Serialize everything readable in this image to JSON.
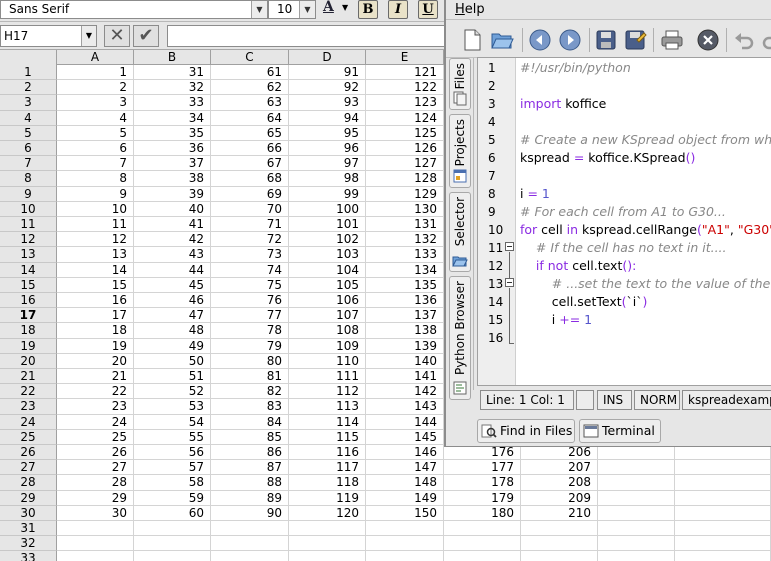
{
  "spreadsheet": {
    "font_name": "Sans Serif",
    "font_size": "10",
    "bold_label": "B",
    "italic_label": "I",
    "underline_label": "U",
    "font_color_label": "A",
    "cell_reference": "H17",
    "cancel_glyph": "✕",
    "accept_glyph": "✔",
    "formula_value": "",
    "active_row": 17,
    "columns": [
      "A",
      "B",
      "C",
      "D",
      "E"
    ],
    "rows": [
      {
        "label": "1",
        "cells": [
          "1",
          "31",
          "61",
          "91",
          "121",
          "",
          ""
        ]
      },
      {
        "label": "2",
        "cells": [
          "2",
          "32",
          "62",
          "92",
          "122",
          "",
          ""
        ]
      },
      {
        "label": "3",
        "cells": [
          "3",
          "33",
          "63",
          "93",
          "123",
          "",
          ""
        ]
      },
      {
        "label": "4",
        "cells": [
          "4",
          "34",
          "64",
          "94",
          "124",
          "",
          ""
        ]
      },
      {
        "label": "5",
        "cells": [
          "5",
          "35",
          "65",
          "95",
          "125",
          "",
          ""
        ]
      },
      {
        "label": "6",
        "cells": [
          "6",
          "36",
          "66",
          "96",
          "126",
          "",
          ""
        ]
      },
      {
        "label": "7",
        "cells": [
          "7",
          "37",
          "67",
          "97",
          "127",
          "",
          ""
        ]
      },
      {
        "label": "8",
        "cells": [
          "8",
          "38",
          "68",
          "98",
          "128",
          "",
          ""
        ]
      },
      {
        "label": "9",
        "cells": [
          "9",
          "39",
          "69",
          "99",
          "129",
          "",
          ""
        ]
      },
      {
        "label": "10",
        "cells": [
          "10",
          "40",
          "70",
          "100",
          "130",
          "",
          ""
        ]
      },
      {
        "label": "11",
        "cells": [
          "11",
          "41",
          "71",
          "101",
          "131",
          "",
          ""
        ]
      },
      {
        "label": "12",
        "cells": [
          "12",
          "42",
          "72",
          "102",
          "132",
          "",
          ""
        ]
      },
      {
        "label": "13",
        "cells": [
          "13",
          "43",
          "73",
          "103",
          "133",
          "",
          ""
        ]
      },
      {
        "label": "14",
        "cells": [
          "14",
          "44",
          "74",
          "104",
          "134",
          "",
          ""
        ]
      },
      {
        "label": "15",
        "cells": [
          "15",
          "45",
          "75",
          "105",
          "135",
          "",
          ""
        ]
      },
      {
        "label": "16",
        "cells": [
          "16",
          "46",
          "76",
          "106",
          "136",
          "",
          ""
        ]
      },
      {
        "label": "17",
        "cells": [
          "17",
          "47",
          "77",
          "107",
          "137",
          "",
          ""
        ]
      },
      {
        "label": "18",
        "cells": [
          "18",
          "48",
          "78",
          "108",
          "138",
          "",
          ""
        ]
      },
      {
        "label": "19",
        "cells": [
          "19",
          "49",
          "79",
          "109",
          "139",
          "",
          ""
        ]
      },
      {
        "label": "20",
        "cells": [
          "20",
          "50",
          "80",
          "110",
          "140",
          "",
          ""
        ]
      },
      {
        "label": "21",
        "cells": [
          "21",
          "51",
          "81",
          "111",
          "141",
          "",
          ""
        ]
      },
      {
        "label": "22",
        "cells": [
          "22",
          "52",
          "82",
          "112",
          "142",
          "",
          ""
        ]
      },
      {
        "label": "23",
        "cells": [
          "23",
          "53",
          "83",
          "113",
          "143",
          "",
          ""
        ]
      },
      {
        "label": "24",
        "cells": [
          "24",
          "54",
          "84",
          "114",
          "144",
          "",
          ""
        ]
      },
      {
        "label": "25",
        "cells": [
          "25",
          "55",
          "85",
          "115",
          "145",
          "",
          ""
        ]
      },
      {
        "label": "26",
        "cells": [
          "26",
          "56",
          "86",
          "116",
          "146",
          "176",
          "206"
        ]
      },
      {
        "label": "27",
        "cells": [
          "27",
          "57",
          "87",
          "117",
          "147",
          "177",
          "207"
        ]
      },
      {
        "label": "28",
        "cells": [
          "28",
          "58",
          "88",
          "118",
          "148",
          "178",
          "208"
        ]
      },
      {
        "label": "29",
        "cells": [
          "29",
          "59",
          "89",
          "119",
          "149",
          "179",
          "209"
        ]
      },
      {
        "label": "30",
        "cells": [
          "30",
          "60",
          "90",
          "120",
          "150",
          "180",
          "210"
        ]
      },
      {
        "label": "31",
        "cells": [
          "",
          "",
          "",
          "",
          "",
          "",
          ""
        ]
      },
      {
        "label": "32",
        "cells": [
          "",
          "",
          "",
          "",
          "",
          "",
          ""
        ]
      },
      {
        "label": "33",
        "cells": [
          "",
          "",
          "",
          "",
          "",
          "",
          ""
        ]
      }
    ]
  },
  "kate": {
    "menu": {
      "help": "Help"
    },
    "toolbar_icons": [
      "new-document-icon",
      "open-folder-icon",
      "back-icon",
      "forward-icon",
      "save-icon",
      "save-as-icon",
      "print-icon",
      "close-document-icon",
      "undo-icon",
      "redo-icon"
    ],
    "side_tabs": [
      "Files",
      "Projects",
      "Selector",
      "Python Browser"
    ],
    "code_lines": [
      {
        "n": "1",
        "tokens": [
          {
            "t": "#!/usr/bin/python",
            "c": "c-comment"
          }
        ]
      },
      {
        "n": "2",
        "tokens": []
      },
      {
        "n": "3",
        "tokens": [
          {
            "t": "import",
            "c": "c-kw"
          },
          {
            "t": " koffice",
            "c": ""
          }
        ]
      },
      {
        "n": "4",
        "tokens": []
      },
      {
        "n": "5",
        "tokens": [
          {
            "t": "# Create a new KSpread object from wh",
            "c": "c-comment"
          }
        ]
      },
      {
        "n": "6",
        "tokens": [
          {
            "t": "kspread ",
            "c": ""
          },
          {
            "t": "=",
            "c": "c-op"
          },
          {
            "t": " koffice.KSpread",
            "c": ""
          },
          {
            "t": "()",
            "c": "c-op"
          }
        ]
      },
      {
        "n": "7",
        "tokens": []
      },
      {
        "n": "8",
        "tokens": [
          {
            "t": "i ",
            "c": ""
          },
          {
            "t": "=",
            "c": "c-op"
          },
          {
            "t": " ",
            "c": ""
          },
          {
            "t": "1",
            "c": "c-num"
          }
        ]
      },
      {
        "n": "9",
        "tokens": [
          {
            "t": "# For each cell from A1 to G30...",
            "c": "c-comment"
          }
        ]
      },
      {
        "n": "10",
        "tokens": [
          {
            "t": "for",
            "c": "c-kw"
          },
          {
            "t": " cell ",
            "c": ""
          },
          {
            "t": "in",
            "c": "c-kw"
          },
          {
            "t": " kspread.cellRange",
            "c": ""
          },
          {
            "t": "(",
            "c": "c-op"
          },
          {
            "t": "\"A1\"",
            "c": "c-str"
          },
          {
            "t": ", ",
            "c": ""
          },
          {
            "t": "\"G30\"",
            "c": "c-str"
          },
          {
            "t": ")",
            "c": "c-op"
          }
        ]
      },
      {
        "n": "11",
        "tokens": [
          {
            "t": "    ",
            "c": ""
          },
          {
            "t": "# If the cell has no text in it....",
            "c": "c-comment"
          }
        ]
      },
      {
        "n": "12",
        "tokens": [
          {
            "t": "    ",
            "c": ""
          },
          {
            "t": "if not",
            "c": "c-kw"
          },
          {
            "t": " cell.text",
            "c": ""
          },
          {
            "t": "():",
            "c": "c-op"
          }
        ]
      },
      {
        "n": "13",
        "tokens": [
          {
            "t": "        ",
            "c": ""
          },
          {
            "t": "# ...set the text to the value of the",
            "c": "c-comment"
          }
        ]
      },
      {
        "n": "14",
        "tokens": [
          {
            "t": "        cell.setText",
            "c": ""
          },
          {
            "t": "(",
            "c": "c-op"
          },
          {
            "t": "`i`",
            "c": ""
          },
          {
            "t": ")",
            "c": "c-op"
          }
        ]
      },
      {
        "n": "15",
        "tokens": [
          {
            "t": "        i ",
            "c": ""
          },
          {
            "t": "+=",
            "c": "c-op"
          },
          {
            "t": " ",
            "c": ""
          },
          {
            "t": "1",
            "c": "c-num"
          }
        ]
      },
      {
        "n": "16",
        "tokens": []
      }
    ],
    "status": {
      "position": "Line: 1 Col: 1",
      "modified": "",
      "insert_mode": "INS",
      "edit_mode": "NORM",
      "filename": "kspreadexample.py"
    },
    "bottom_tabs": [
      "Find in Files",
      "Terminal"
    ],
    "colors": {
      "comment": "#888888",
      "keyword": "#8a2be2",
      "string": "#cc0000",
      "number": "#5555cc"
    }
  }
}
